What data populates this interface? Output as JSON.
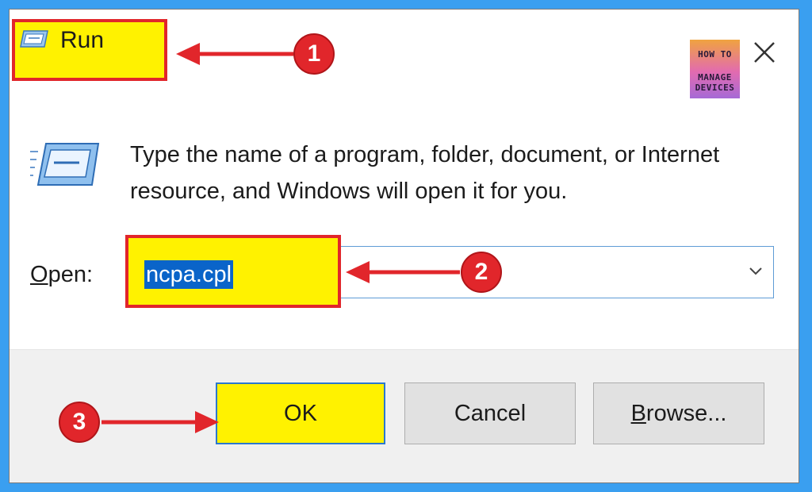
{
  "window": {
    "title": "Run",
    "close_icon": "close-icon"
  },
  "logo": {
    "line1": "HOW TO",
    "line2": "MANAGE",
    "line3": "DEVICES"
  },
  "description": "Type the name of a program, folder, document, or Internet resource, and Windows will open it for you.",
  "open_field": {
    "label_prefix": "O",
    "label_rest": "pen:",
    "value": "ncpa.cpl"
  },
  "buttons": {
    "ok": "OK",
    "cancel": "Cancel",
    "browse_prefix": "B",
    "browse_rest": "rowse..."
  },
  "annotations": {
    "step1": "1",
    "step2": "2",
    "step3": "3"
  },
  "colors": {
    "highlight": "#fff200",
    "annotation_red": "#e1262b",
    "background_blue": "#3a9ff0",
    "selection_blue": "#0a64c9"
  }
}
